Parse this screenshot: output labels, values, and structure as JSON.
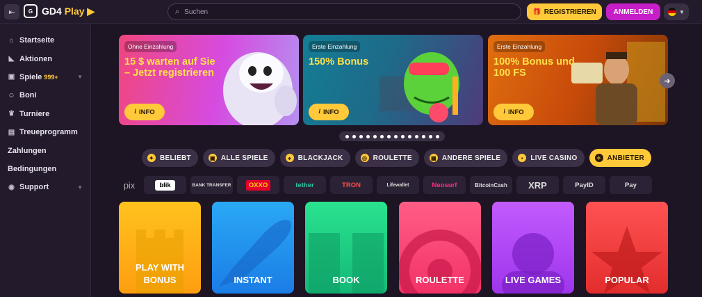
{
  "header": {
    "logo_text": "GD4",
    "logo_accent": "Play",
    "search_placeholder": "Suchen",
    "register_label": "REGISTRIEREN",
    "login_label": "ANMELDEN",
    "colors": {
      "accent_yellow": "#ffc93a",
      "accent_magenta": "#c71fc7",
      "background": "#1d1424"
    }
  },
  "sidebar": {
    "items": [
      {
        "label": "Startseite",
        "icon": "home-icon"
      },
      {
        "label": "Aktionen",
        "icon": "megaphone-icon"
      },
      {
        "label": "Spiele",
        "badge": "999+",
        "icon": "gamepad-icon"
      },
      {
        "label": "Boni",
        "icon": "smile-icon"
      },
      {
        "label": "Turniere",
        "icon": "trophy-icon"
      },
      {
        "label": "Treueprogramm",
        "icon": "loyalty-icon"
      },
      {
        "label": "Zahlungen"
      },
      {
        "label": "Bedingungen"
      },
      {
        "label": "Support",
        "icon": "support-icon"
      }
    ]
  },
  "banners": [
    {
      "tag": "Ohne Einzahlung",
      "title": "15 $ warten auf Sie – Jetzt registrieren",
      "button": "INFO"
    },
    {
      "tag": "Erste Einzahlung",
      "title": "150% Bonus",
      "button": "INFO"
    },
    {
      "tag": "Erste Einzahlung",
      "title": "100% Bonus und 100 FS",
      "button": "INFO"
    }
  ],
  "categories": [
    {
      "label": "BELIEBT",
      "icon": "flame-icon"
    },
    {
      "label": "ALLE SPIELE",
      "icon": "gamepad-icon"
    },
    {
      "label": "BLACKJACK",
      "icon": "spade-icon"
    },
    {
      "label": "ROULETTE",
      "icon": "roulette-icon"
    },
    {
      "label": "ANDERE SPIELE",
      "icon": "grid-icon"
    },
    {
      "label": "LIVE CASINO",
      "icon": "live-icon"
    },
    {
      "label": "ANBIETER",
      "icon": "compass-icon",
      "active": true
    }
  ],
  "payments": [
    "pix",
    "blik",
    "BANK TRANSFER",
    "OXXO",
    "tether",
    "TRON",
    "Lifewallet",
    "Neosurf",
    "BitcoinCash",
    "XRP",
    "PayID",
    "Pay"
  ],
  "tiles": [
    {
      "label": "PLAY WITH BONUS"
    },
    {
      "label": "INSTANT"
    },
    {
      "label": "BOOK"
    },
    {
      "label": "ROULETTE"
    },
    {
      "label": "LIVE GAMES"
    },
    {
      "label": "POPULAR"
    }
  ]
}
